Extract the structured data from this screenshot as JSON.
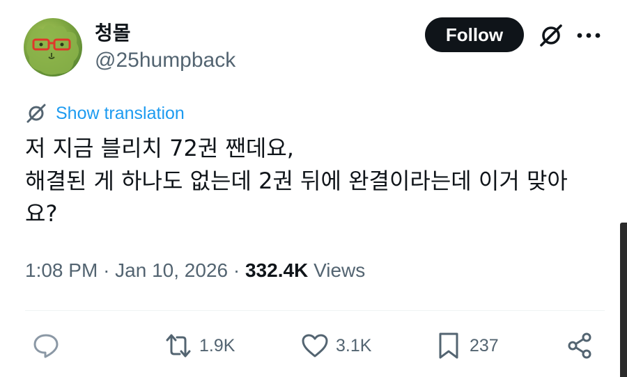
{
  "author": {
    "display_name": "청몰",
    "handle": "@25humpback"
  },
  "header": {
    "follow_label": "Follow",
    "grok_icon": "grok-icon",
    "more_icon": "more-icon"
  },
  "translation": {
    "label": "Show translation",
    "icon": "grok-icon"
  },
  "tweet": {
    "text": "저 지금 블리치 72권 짼데요,\n해결된 게 하나도 없는데 2권 뒤에 완결이라는데 이거 맞아\n요?"
  },
  "meta": {
    "time": "1:08 PM",
    "date": "Jan 10, 2026",
    "views_count": "332.4K",
    "views_label": "Views"
  },
  "actions": {
    "reply": {
      "icon": "reply-icon",
      "count": ""
    },
    "retweet": {
      "icon": "retweet-icon",
      "count": "1.9K"
    },
    "like": {
      "icon": "heart-icon",
      "count": "3.1K"
    },
    "bookmark": {
      "icon": "bookmark-icon",
      "count": "237"
    },
    "share": {
      "icon": "share-icon"
    }
  },
  "colors": {
    "text": "#0f1419",
    "secondary": "#536471",
    "link": "#1d9bf0",
    "button_bg": "#0f1419",
    "divider": "#eff3f4"
  }
}
